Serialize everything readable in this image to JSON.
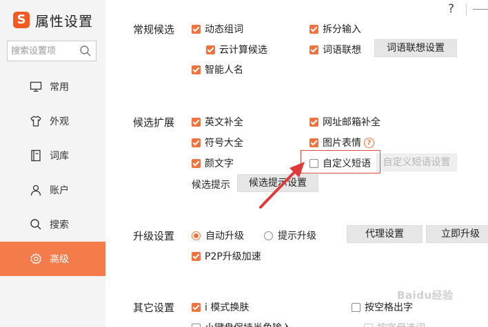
{
  "app": {
    "title": "属性设置"
  },
  "window": {
    "help_label": "?"
  },
  "search": {
    "placeholder": "搜索设置项"
  },
  "nav": [
    {
      "label": "常用",
      "icon": "monitor-icon"
    },
    {
      "label": "外观",
      "icon": "shirt-icon"
    },
    {
      "label": "词库",
      "icon": "book-icon"
    },
    {
      "label": "账户",
      "icon": "user-icon"
    },
    {
      "label": "搜索",
      "icon": "search-icon"
    },
    {
      "label": "高级",
      "icon": "gear-icon",
      "active": true
    }
  ],
  "sections": {
    "candidates": {
      "label": "常规候选",
      "items": {
        "dynamic_phrase": {
          "label": "动态组词",
          "checked": true
        },
        "split_input": {
          "label": "拆分输入",
          "checked": true
        },
        "cloud": {
          "label": "云计算候选",
          "checked": true
        },
        "association": {
          "label": "词语联想",
          "checked": true
        },
        "smart_name": {
          "label": "智能人名",
          "checked": true
        }
      },
      "association_settings": "词语联想设置"
    },
    "extend": {
      "label": "候选扩展",
      "items": {
        "english": {
          "label": "英文补全",
          "checked": true
        },
        "url_email": {
          "label": "网址邮箱补全",
          "checked": true
        },
        "symbols": {
          "label": "符号大全",
          "checked": true
        },
        "picture": {
          "label": "图片表情",
          "checked": true
        },
        "kaomoji": {
          "label": "颜文字",
          "checked": true
        },
        "custom_phrase": {
          "label": "自定义短语",
          "checked": false
        }
      },
      "custom_phrase_settings": "自定义短语设置",
      "hint_label": "候选提示",
      "hint_settings": "候选提示设置"
    },
    "upgrade": {
      "label": "升级设置",
      "auto": "自动升级",
      "prompt": "提示升级",
      "proxy": "代理设置",
      "upgrade_now": "立即升级",
      "p2p": {
        "label": "P2P升级加速",
        "checked": true
      }
    },
    "other": {
      "label": "其它设置",
      "i_mode": {
        "label": "i 模式换肤",
        "checked": true
      },
      "space_output": {
        "label": "按空格出字",
        "checked": false
      },
      "keyboard_half": {
        "label": "小键盘保持半角输入",
        "checked": false
      },
      "by_letter": {
        "label": "按字母选词",
        "checked": false
      }
    }
  },
  "colors": {
    "accent": "#f47b4a",
    "highlight": "#e04545"
  },
  "watermark": "Baidu经验"
}
